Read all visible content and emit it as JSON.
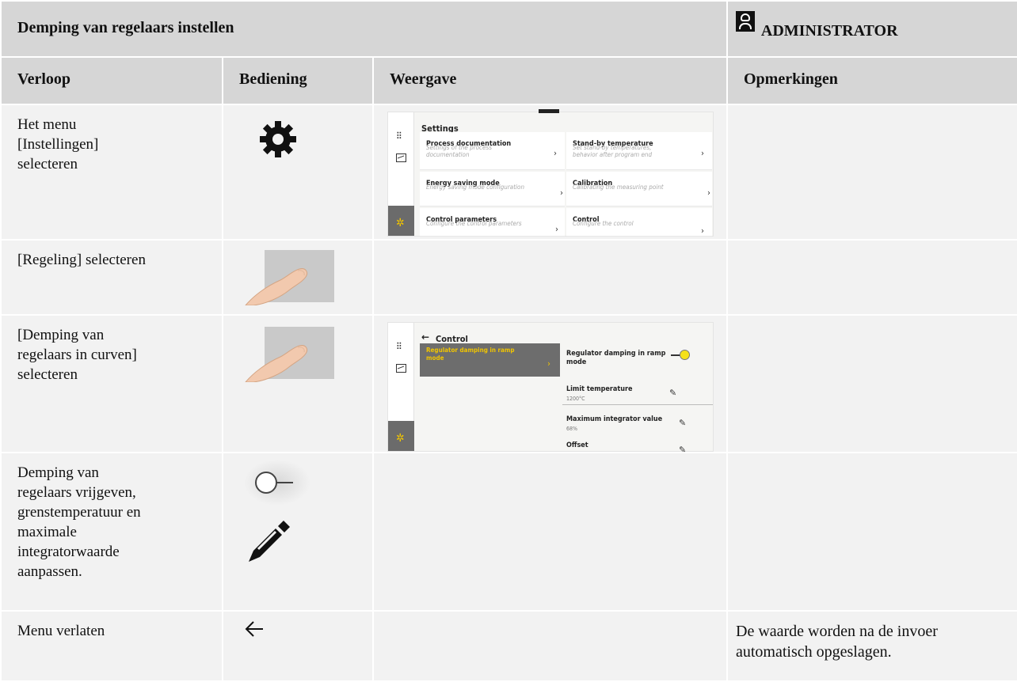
{
  "header": {
    "title": "Demping van regelaars instellen",
    "role": "ADMINISTRATOR"
  },
  "columns": [
    "Verloop",
    "Bediening",
    "Weergave",
    "Opmerkingen"
  ],
  "rows": [
    {
      "step": "Het menu\n[Instellingen]\nselecteren",
      "remark": ""
    },
    {
      "step": "[Regeling]  selecteren",
      "remark": ""
    },
    {
      "step": "[Demping van\nregelaars in curven]\nselecteren",
      "remark": ""
    },
    {
      "step": "Demping van\nregelaars vrijgeven,\ngrenstemperatuur en\nmaximale\nintegratorwaarde\naanpassen.",
      "remark": ""
    },
    {
      "step": "Menu verlaten",
      "remark": "De waarde worden na de invoer automatisch opgeslagen."
    }
  ],
  "settings_screen": {
    "title": "Settings",
    "tiles": [
      {
        "title": "Process documentation",
        "subtitle": "Settings of the process\ndocumentation"
      },
      {
        "title": "Stand-by temperature",
        "subtitle": "Set stand-by temperatures,\nbehavior after program end"
      },
      {
        "title": "Energy saving mode",
        "subtitle": "Energy saving mode configuration"
      },
      {
        "title": "Calibration",
        "subtitle": "Calibrating the measuring point"
      },
      {
        "title": "Control parameters",
        "subtitle": "Configure the control parameters"
      },
      {
        "title": "Control",
        "subtitle": "Configure the control"
      }
    ]
  },
  "control_screen": {
    "title": "Control",
    "selected_item": "Regulator damping in ramp\nmode",
    "right_items": [
      {
        "title": "Regulator damping in ramp\nmode",
        "value": ""
      },
      {
        "title": "Limit temperature",
        "value": "1200°C"
      },
      {
        "title": "Maximum integrator value",
        "value": "68%"
      },
      {
        "title": "Offset",
        "value": ""
      }
    ]
  },
  "icons": {
    "row1": "gear-icon",
    "row2": "finger-tap-icon",
    "row3": "finger-tap-icon",
    "row4": [
      "toggle-off-icon",
      "pencil-icon"
    ],
    "row5": "back-arrow-icon",
    "accent": "#f0c400"
  }
}
